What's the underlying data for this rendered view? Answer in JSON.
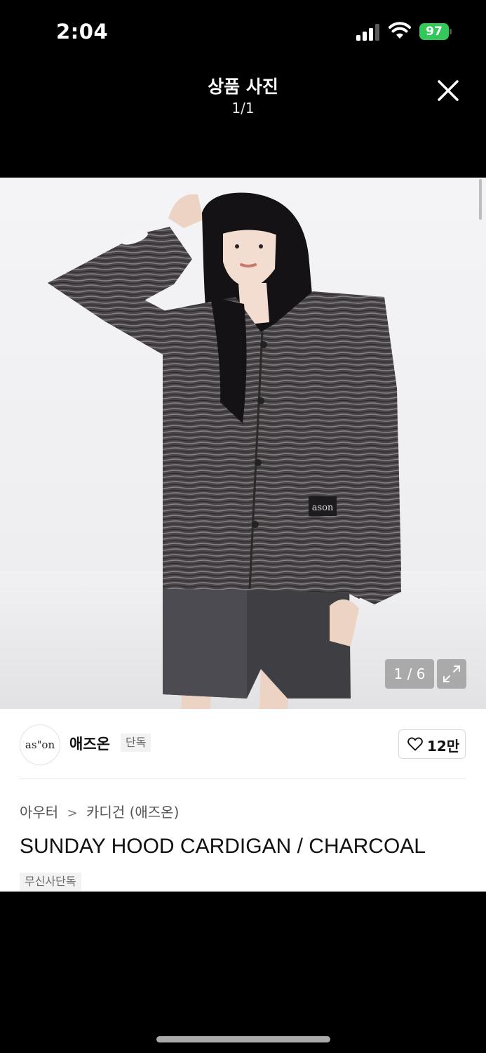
{
  "status_bar": {
    "time": "2:04",
    "battery": "97"
  },
  "viewer": {
    "title": "상품 사진",
    "counter": "1/1"
  },
  "photo": {
    "counter": "1 / 6",
    "shirt_label": "ason"
  },
  "seller": {
    "avatar_text": "as\"on",
    "name": "애즈온",
    "badge": "단독",
    "likes": "12만"
  },
  "product": {
    "breadcrumb": [
      "아우터",
      "카디건 (애즈온)"
    ],
    "breadcrumb_separator": ">",
    "title": "SUNDAY HOOD CARDIGAN / CHARCOAL",
    "tag": "무신사단독"
  }
}
